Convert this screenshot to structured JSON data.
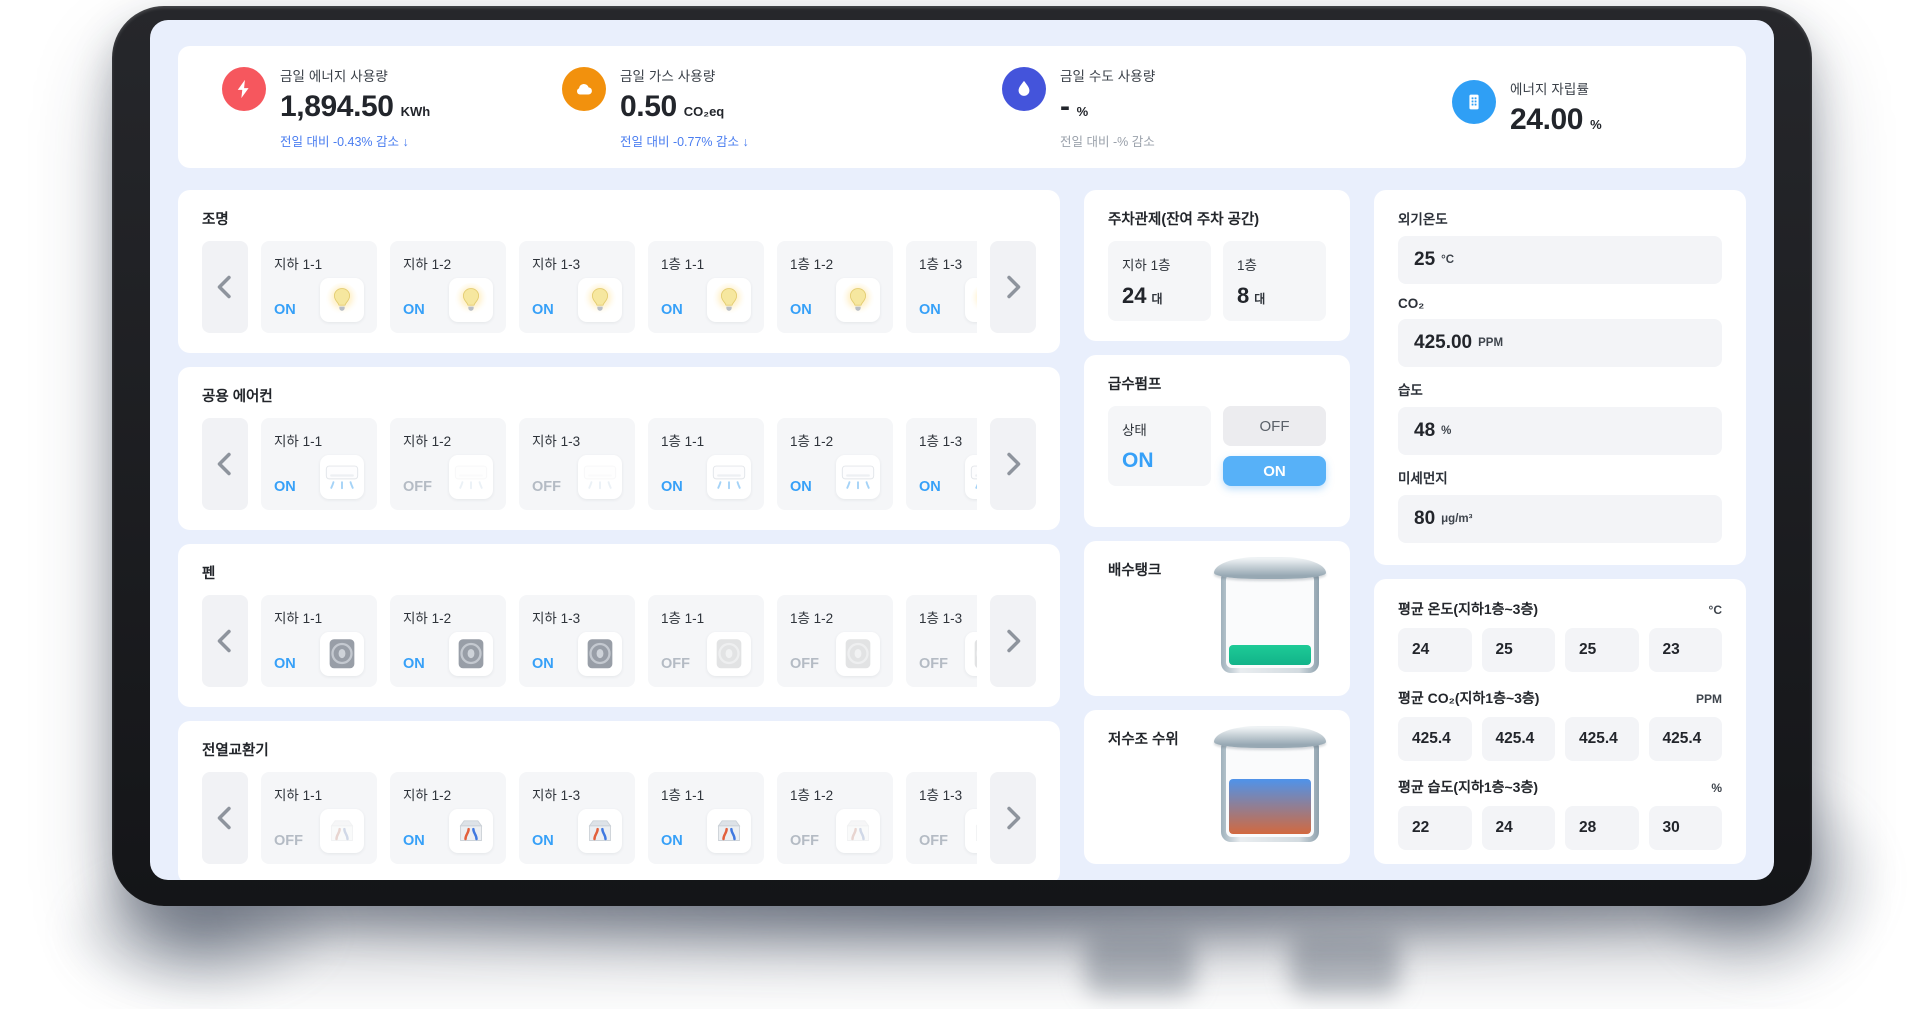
{
  "kpis": [
    {
      "icon": "lightning-icon",
      "icon_bg": "#f6575e",
      "title": "금일 에너지 사용량",
      "value": "1,894.50",
      "unit": "KWh",
      "sub": "전일 대비 -0.43% 감소 ↓"
    },
    {
      "icon": "gas-cloud-icon",
      "icon_bg": "#f2910d",
      "title": "금일 가스 사용량",
      "value": "0.50",
      "unit": "CO₂eq",
      "sub": "전일 대비 -0.77% 감소 ↓"
    },
    {
      "icon": "water-drop-icon",
      "icon_bg": "#4454db",
      "title": "금일 수도 사용량",
      "value": "-",
      "unit": "%",
      "sub": "전일 대비 -% 감소"
    },
    {
      "icon": "building-icon",
      "icon_bg": "#2f9ff5",
      "title": "에너지 자립률",
      "value": "24.00",
      "unit": "%",
      "sub": ""
    }
  ],
  "sections": [
    {
      "title": "조명",
      "device": "light",
      "cards": [
        {
          "name": "지하 1-1",
          "status": "ON"
        },
        {
          "name": "지하 1-2",
          "status": "ON"
        },
        {
          "name": "지하 1-3",
          "status": "ON"
        },
        {
          "name": "1층 1-1",
          "status": "ON"
        },
        {
          "name": "1층 1-2",
          "status": "ON"
        },
        {
          "name": "1층 1-3",
          "status": "ON"
        }
      ]
    },
    {
      "title": "공용 에어컨",
      "device": "air-conditioner",
      "cards": [
        {
          "name": "지하 1-1",
          "status": "ON"
        },
        {
          "name": "지하 1-2",
          "status": "OFF"
        },
        {
          "name": "지하 1-3",
          "status": "OFF"
        },
        {
          "name": "1층 1-1",
          "status": "ON"
        },
        {
          "name": "1층 1-2",
          "status": "ON"
        },
        {
          "name": "1층 1-3",
          "status": "ON"
        }
      ]
    },
    {
      "title": "펜",
      "device": "fan",
      "cards": [
        {
          "name": "지하 1-1",
          "status": "ON"
        },
        {
          "name": "지하 1-2",
          "status": "ON"
        },
        {
          "name": "지하 1-3",
          "status": "ON"
        },
        {
          "name": "1층 1-1",
          "status": "OFF"
        },
        {
          "name": "1층 1-2",
          "status": "OFF"
        },
        {
          "name": "1층 1-3",
          "status": "OFF"
        }
      ]
    },
    {
      "title": "전열교환기",
      "device": "heat-exchanger",
      "cards": [
        {
          "name": "지하 1-1",
          "status": "OFF"
        },
        {
          "name": "지하 1-2",
          "status": "ON"
        },
        {
          "name": "지하 1-3",
          "status": "ON"
        },
        {
          "name": "1층 1-1",
          "status": "ON"
        },
        {
          "name": "1층 1-2",
          "status": "OFF"
        },
        {
          "name": "1층 1-3",
          "status": "OFF"
        }
      ]
    }
  ],
  "parking": {
    "title": "주차관제(잔여 주차 공간)",
    "slots": [
      {
        "name": "지하 1층",
        "value": "24",
        "unit": "대"
      },
      {
        "name": "1층",
        "value": "8",
        "unit": "대"
      }
    ]
  },
  "pump": {
    "title": "급수펌프",
    "state_label": "상태",
    "state": "ON",
    "off_button": "OFF",
    "on_button": "ON"
  },
  "drain_tank": {
    "title": "배수탱크",
    "level_pct": 21,
    "fill_color": "#15c492"
  },
  "reservoir": {
    "title": "저수조 수위",
    "level_pct": 58,
    "fill_top_color": "#4f93ea",
    "fill_bottom_color": "#d2693f"
  },
  "environment": {
    "items": [
      {
        "label": "외기온도",
        "value": "25",
        "unit": "°C"
      },
      {
        "label": "CO₂",
        "value": "425.00",
        "unit": "PPM"
      },
      {
        "label": "습도",
        "value": "48",
        "unit": "%"
      },
      {
        "label": "미세먼지",
        "value": "80",
        "unit": "μg/m³"
      }
    ]
  },
  "averages": {
    "rows": [
      {
        "label": "평균 온도(지하1층~3층)",
        "unit": "°C",
        "values": [
          "24",
          "25",
          "25",
          "23"
        ]
      },
      {
        "label": "평균 CO₂(지하1층~3층)",
        "unit": "PPM",
        "values": [
          "425.4",
          "425.4",
          "425.4",
          "425.4"
        ]
      },
      {
        "label": "평균 습도(지하1층~3층)",
        "unit": "%",
        "values": [
          "22",
          "24",
          "28",
          "30"
        ]
      }
    ]
  },
  "colors": {
    "status_on": "#36a0f8",
    "status_off": "#b4bbc4",
    "pump_on_button": "#57b1f8",
    "kpi_sub_blue": "#4a7df0",
    "screen_bg": "#e9effc"
  }
}
